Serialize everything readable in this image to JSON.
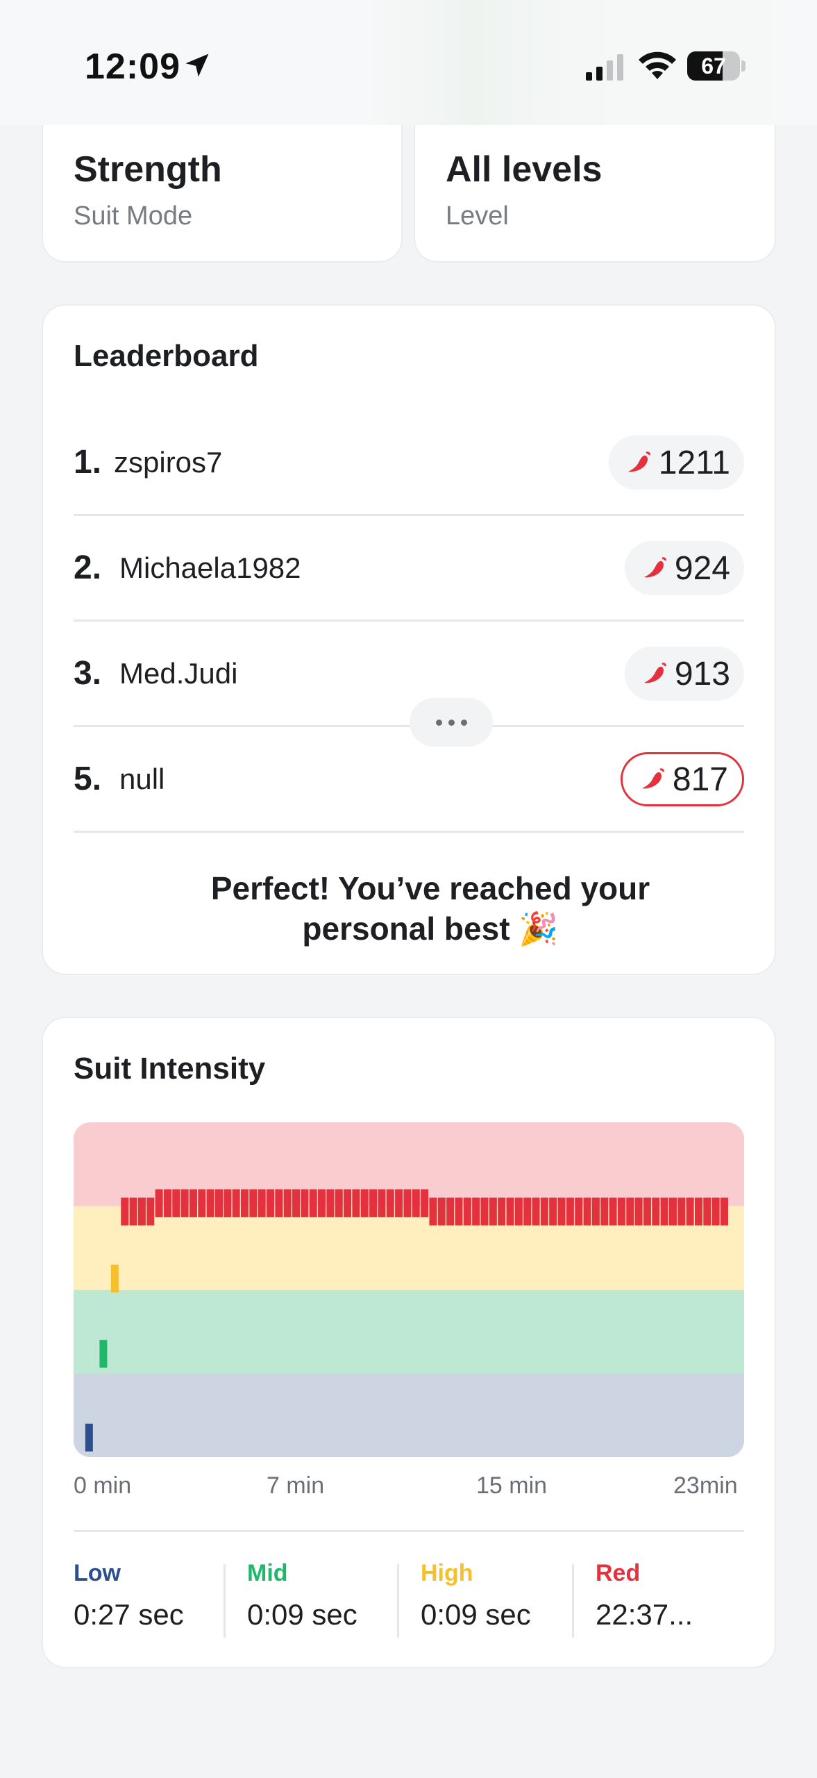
{
  "status_bar": {
    "time": "12:09",
    "battery_percent": "67",
    "battery_level": 0.67
  },
  "top_cards": [
    {
      "value": "Strength",
      "label": "Suit Mode"
    },
    {
      "value": "All levels",
      "label": "Level"
    }
  ],
  "leaderboard": {
    "title": "Leaderboard",
    "rows": [
      {
        "rank": "1.",
        "name": "zspiros7",
        "score": "1211",
        "is_user": false
      },
      {
        "rank": "2.",
        "name": "Michaela1982",
        "score": "924",
        "is_user": false
      },
      {
        "rank": "3.",
        "name": "Med.Judi",
        "score": "913",
        "is_user": false
      },
      {
        "rank": "5.",
        "name": "null",
        "score": "817",
        "is_user": true
      }
    ],
    "message_line1": "Perfect! You’ve reached your",
    "message_line2": "personal best 🎉"
  },
  "intensity": {
    "title": "Suit Intensity",
    "stats": [
      {
        "label": "Low",
        "value": "0:27 sec",
        "color": "#2c4f8f"
      },
      {
        "label": "Mid",
        "value": "0:09 sec",
        "color": "#1fb86a"
      },
      {
        "label": "High",
        "value": "0:09 sec",
        "color": "#f5c02b"
      },
      {
        "label": "Red",
        "value": "22:37...",
        "color": "#e3313d"
      }
    ]
  },
  "chart_data": {
    "type": "bar",
    "title": "Suit Intensity",
    "x_tick_labels": [
      "0 min",
      "7 min",
      "15 min",
      "23min"
    ],
    "xlim": [
      0,
      23
    ],
    "bands": [
      {
        "name": "Low",
        "color": "#cdd5e3",
        "bar_color": "#2c4f8f"
      },
      {
        "name": "Mid",
        "color": "#bfe8d4",
        "bar_color": "#1fb86a"
      },
      {
        "name": "High",
        "color": "#ffeebe",
        "bar_color": "#f5c02b"
      },
      {
        "name": "Red",
        "color": "#f9ccd0",
        "bar_color": "#e3313d"
      }
    ],
    "ylim": [
      0,
      4
    ],
    "bars": [
      {
        "t": 0.3,
        "level": 0.4,
        "band": "Low"
      },
      {
        "t": 0.8,
        "level": 1.4,
        "band": "Mid"
      },
      {
        "t": 1.2,
        "level": 2.3,
        "band": "High"
      },
      {
        "t": 1.55,
        "level": 3.1,
        "band": "Red"
      },
      {
        "t": 1.85,
        "level": 3.1,
        "band": "Red"
      },
      {
        "t": 2.15,
        "level": 3.1,
        "band": "Red"
      },
      {
        "t": 2.45,
        "level": 3.1,
        "band": "Red"
      },
      {
        "t": 2.75,
        "level": 3.2,
        "band": "Red"
      },
      {
        "t": 3.05,
        "level": 3.2,
        "band": "Red"
      },
      {
        "t": 3.35,
        "level": 3.2,
        "band": "Red"
      },
      {
        "t": 3.65,
        "level": 3.2,
        "band": "Red"
      },
      {
        "t": 3.95,
        "level": 3.2,
        "band": "Red"
      },
      {
        "t": 4.25,
        "level": 3.2,
        "band": "Red"
      },
      {
        "t": 4.55,
        "level": 3.2,
        "band": "Red"
      },
      {
        "t": 4.85,
        "level": 3.2,
        "band": "Red"
      },
      {
        "t": 5.15,
        "level": 3.2,
        "band": "Red"
      },
      {
        "t": 5.45,
        "level": 3.2,
        "band": "Red"
      },
      {
        "t": 5.75,
        "level": 3.2,
        "band": "Red"
      },
      {
        "t": 6.05,
        "level": 3.2,
        "band": "Red"
      },
      {
        "t": 6.35,
        "level": 3.2,
        "band": "Red"
      },
      {
        "t": 6.65,
        "level": 3.2,
        "band": "Red"
      },
      {
        "t": 6.95,
        "level": 3.2,
        "band": "Red"
      },
      {
        "t": 7.25,
        "level": 3.2,
        "band": "Red"
      },
      {
        "t": 7.55,
        "level": 3.2,
        "band": "Red"
      },
      {
        "t": 7.85,
        "level": 3.2,
        "band": "Red"
      },
      {
        "t": 8.15,
        "level": 3.2,
        "band": "Red"
      },
      {
        "t": 8.45,
        "level": 3.2,
        "band": "Red"
      },
      {
        "t": 8.75,
        "level": 3.2,
        "band": "Red"
      },
      {
        "t": 9.05,
        "level": 3.2,
        "band": "Red"
      },
      {
        "t": 9.35,
        "level": 3.2,
        "band": "Red"
      },
      {
        "t": 9.65,
        "level": 3.2,
        "band": "Red"
      },
      {
        "t": 9.95,
        "level": 3.2,
        "band": "Red"
      },
      {
        "t": 10.25,
        "level": 3.2,
        "band": "Red"
      },
      {
        "t": 10.55,
        "level": 3.2,
        "band": "Red"
      },
      {
        "t": 10.85,
        "level": 3.2,
        "band": "Red"
      },
      {
        "t": 11.15,
        "level": 3.2,
        "band": "Red"
      },
      {
        "t": 11.45,
        "level": 3.2,
        "band": "Red"
      },
      {
        "t": 11.75,
        "level": 3.2,
        "band": "Red"
      },
      {
        "t": 12.05,
        "level": 3.2,
        "band": "Red"
      },
      {
        "t": 12.35,
        "level": 3.1,
        "band": "Red"
      },
      {
        "t": 12.65,
        "level": 3.1,
        "band": "Red"
      },
      {
        "t": 12.95,
        "level": 3.1,
        "band": "Red"
      },
      {
        "t": 13.25,
        "level": 3.1,
        "band": "Red"
      },
      {
        "t": 13.55,
        "level": 3.1,
        "band": "Red"
      },
      {
        "t": 13.85,
        "level": 3.1,
        "band": "Red"
      },
      {
        "t": 14.15,
        "level": 3.1,
        "band": "Red"
      },
      {
        "t": 14.45,
        "level": 3.1,
        "band": "Red"
      },
      {
        "t": 14.75,
        "level": 3.1,
        "band": "Red"
      },
      {
        "t": 15.05,
        "level": 3.1,
        "band": "Red"
      },
      {
        "t": 15.35,
        "level": 3.1,
        "band": "Red"
      },
      {
        "t": 15.65,
        "level": 3.1,
        "band": "Red"
      },
      {
        "t": 15.95,
        "level": 3.1,
        "band": "Red"
      },
      {
        "t": 16.25,
        "level": 3.1,
        "band": "Red"
      },
      {
        "t": 16.55,
        "level": 3.1,
        "band": "Red"
      },
      {
        "t": 16.85,
        "level": 3.1,
        "band": "Red"
      },
      {
        "t": 17.15,
        "level": 3.1,
        "band": "Red"
      },
      {
        "t": 17.45,
        "level": 3.1,
        "band": "Red"
      },
      {
        "t": 17.75,
        "level": 3.1,
        "band": "Red"
      },
      {
        "t": 18.05,
        "level": 3.1,
        "band": "Red"
      },
      {
        "t": 18.35,
        "level": 3.1,
        "band": "Red"
      },
      {
        "t": 18.65,
        "level": 3.1,
        "band": "Red"
      },
      {
        "t": 18.95,
        "level": 3.1,
        "band": "Red"
      },
      {
        "t": 19.25,
        "level": 3.1,
        "band": "Red"
      },
      {
        "t": 19.55,
        "level": 3.1,
        "band": "Red"
      },
      {
        "t": 19.85,
        "level": 3.1,
        "band": "Red"
      },
      {
        "t": 20.15,
        "level": 3.1,
        "band": "Red"
      },
      {
        "t": 20.45,
        "level": 3.1,
        "band": "Red"
      },
      {
        "t": 20.75,
        "level": 3.1,
        "band": "Red"
      },
      {
        "t": 21.05,
        "level": 3.1,
        "band": "Red"
      },
      {
        "t": 21.35,
        "level": 3.1,
        "band": "Red"
      },
      {
        "t": 21.65,
        "level": 3.1,
        "band": "Red"
      },
      {
        "t": 21.95,
        "level": 3.1,
        "band": "Red"
      },
      {
        "t": 22.25,
        "level": 3.1,
        "band": "Red"
      },
      {
        "t": 22.55,
        "level": 3.1,
        "band": "Red"
      }
    ]
  }
}
